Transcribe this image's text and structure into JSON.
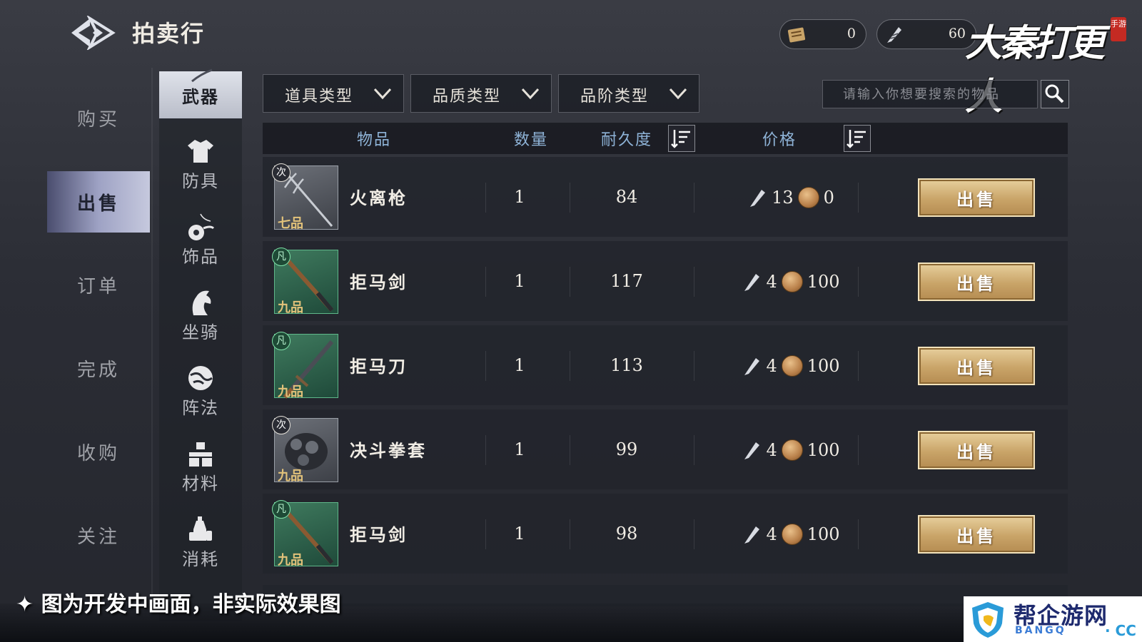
{
  "header": {
    "title": "拍卖行",
    "currencies": [
      {
        "icon": "scroll-ticket-icon",
        "value": "0"
      },
      {
        "icon": "feather-coin-icon",
        "value": "60"
      }
    ],
    "logo_text": "大秦打更人",
    "logo_seal": "手游"
  },
  "left_nav": {
    "items": [
      {
        "label": "购买",
        "active": false
      },
      {
        "label": "出售",
        "active": true
      },
      {
        "label": "订单",
        "active": false
      },
      {
        "label": "完成",
        "active": false
      },
      {
        "label": "收购",
        "active": false
      },
      {
        "label": "关注",
        "active": false
      }
    ]
  },
  "categories": [
    {
      "label": "武器",
      "icon": "brush-icon",
      "active": true
    },
    {
      "label": "防具",
      "icon": "shirt-icon",
      "active": false
    },
    {
      "label": "饰品",
      "icon": "jade-pendant-icon",
      "active": false
    },
    {
      "label": "坐骑",
      "icon": "horse-icon",
      "active": false
    },
    {
      "label": "阵法",
      "icon": "swirl-icon",
      "active": false
    },
    {
      "label": "材料",
      "icon": "blocks-icon",
      "active": false
    },
    {
      "label": "消耗",
      "icon": "bottles-icon",
      "active": false
    }
  ],
  "filters": {
    "item_type": "道具类型",
    "quality_type": "品质类型",
    "rank_type": "品阶类型"
  },
  "search": {
    "placeholder": "请输入你想要搜索的物品"
  },
  "table": {
    "headers": {
      "item": "物品",
      "quantity": "数量",
      "durability": "耐久度",
      "price": "价格"
    },
    "rows": [
      {
        "name": "火离枪",
        "badge": "次",
        "grade": "七品",
        "quality": "gray",
        "quantity": "1",
        "durability": "84",
        "price_feather": "13",
        "price_coin": "0",
        "sell_label": "出售"
      },
      {
        "name": "拒马剑",
        "badge": "凡",
        "grade": "九品",
        "quality": "green",
        "quantity": "1",
        "durability": "117",
        "price_feather": "4",
        "price_coin": "100",
        "sell_label": "出售"
      },
      {
        "name": "拒马刀",
        "badge": "凡",
        "grade": "九品",
        "quality": "green",
        "quantity": "1",
        "durability": "113",
        "price_feather": "4",
        "price_coin": "100",
        "sell_label": "出售"
      },
      {
        "name": "决斗拳套",
        "badge": "次",
        "grade": "九品",
        "quality": "gray",
        "quantity": "1",
        "durability": "99",
        "price_feather": "4",
        "price_coin": "100",
        "sell_label": "出售"
      },
      {
        "name": "拒马剑",
        "badge": "凡",
        "grade": "九品",
        "quality": "green",
        "quantity": "1",
        "durability": "98",
        "price_feather": "4",
        "price_coin": "100",
        "sell_label": "出售"
      }
    ]
  },
  "overlay": {
    "disclaimer": "✦ 图为开发中画面，非实际效果图",
    "watermark_main": "帮企游网",
    "watermark_sub": "BANGQ",
    "watermark_sub2": "· CC"
  }
}
